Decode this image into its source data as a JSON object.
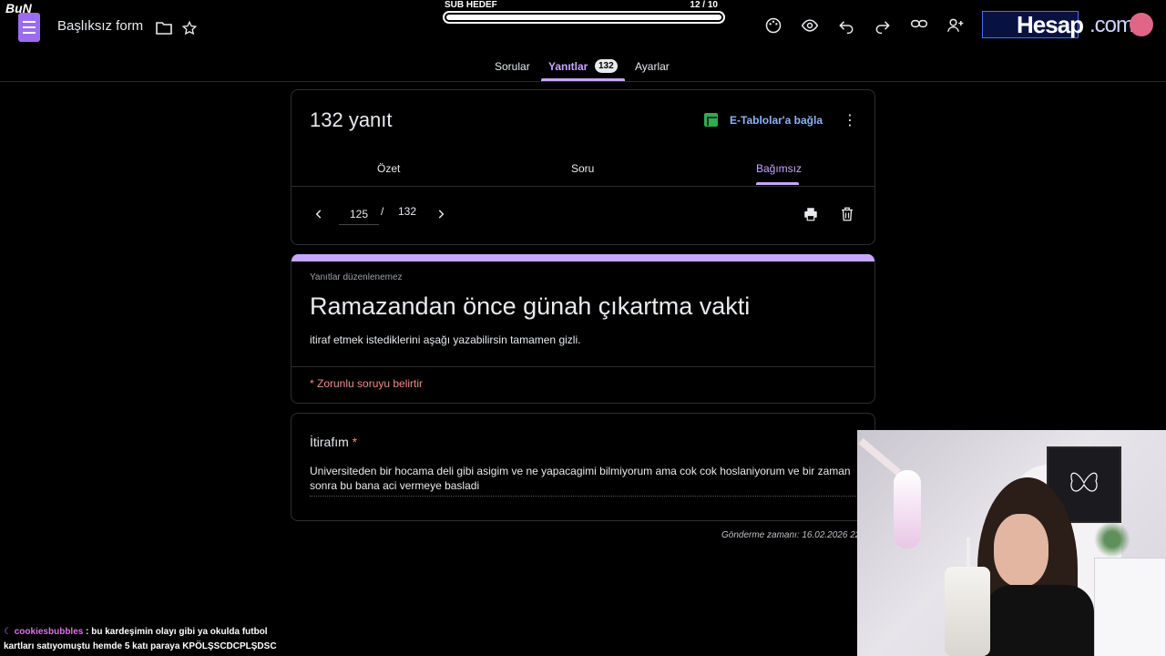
{
  "header": {
    "overlay_logo": "BuN",
    "form_title": "Başlıksız form",
    "sub_hedef_label": "SUB HEDEF",
    "sub_hedef_count": "12  / 10",
    "sub_hedef_progress": 1.0,
    "brand_text": "Hesap",
    "brand_suffix": ".com.tr",
    "icons": [
      "folder-icon",
      "star-icon",
      "palette-icon",
      "preview-icon",
      "undo-icon",
      "redo-icon",
      "link-icon",
      "add-collaborator-icon"
    ]
  },
  "tabs": [
    {
      "label": "Sorular"
    },
    {
      "label": "Yanıtlar",
      "badge": "132"
    },
    {
      "label": "Ayarlar"
    }
  ],
  "responses": {
    "count_label": "132 yanıt",
    "sheets_link": "E-Tablolar'a bağla",
    "subtabs": [
      {
        "label": "Özet"
      },
      {
        "label": "Soru"
      },
      {
        "label": "Bağımsız"
      }
    ],
    "current_page": "125",
    "separator": "/",
    "total_pages": "132"
  },
  "form": {
    "no_edit_note": "Yanıtlar düzenlenemez",
    "title": "Ramazandan önce günah çıkartma vakti",
    "description": "itiraf etmek istediklerini aşağı yazabilirsin tamamen gizli.",
    "required_note": "* Zorunlu soruyu belirtir"
  },
  "question": {
    "title": "İtirafım",
    "required_mark": "*",
    "answer": "Universiteden bir hocama deli gibi asigim ve ne yapacagimi bilmiyorum ama cok cok hoslaniyorum ve bir zaman sonra bu bana aci vermeye basladi"
  },
  "submit_time": "Gönderme zamanı: 16.02.2026 22:",
  "chat": {
    "user": "cookiesbubbles",
    "message": " : bu kardeşimin olayı gibi ya okulda futbol kartları satıyomuştu hemde 5 katı paraya KPÖLŞSCDCPLŞDSC"
  },
  "colors": {
    "accent": "#c8a6ff",
    "link": "#8ab4f8",
    "required": "#f28b82",
    "sheets": "#34a853"
  }
}
